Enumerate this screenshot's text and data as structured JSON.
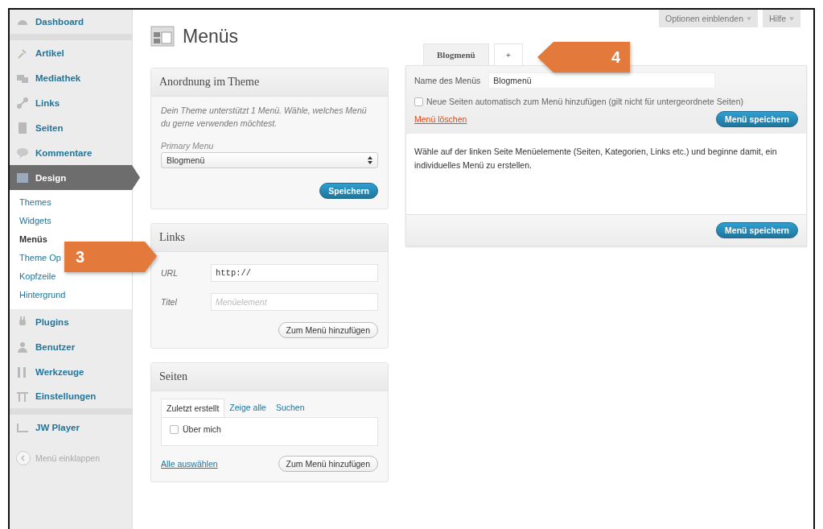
{
  "sidebar": {
    "items": [
      {
        "label": "Dashboard",
        "selected": false,
        "group_end": true
      },
      {
        "label": "Artikel",
        "selected": false
      },
      {
        "label": "Mediathek",
        "selected": false
      },
      {
        "label": "Links",
        "selected": false
      },
      {
        "label": "Seiten",
        "selected": false
      },
      {
        "label": "Kommentare",
        "selected": false
      },
      {
        "label": "Design",
        "selected": true,
        "children": [
          {
            "label": "Themes",
            "selected": false
          },
          {
            "label": "Widgets",
            "selected": false
          },
          {
            "label": "Menüs",
            "selected": true
          },
          {
            "label": "Theme Op",
            "selected": false
          },
          {
            "label": "Kopfzeile",
            "selected": false
          },
          {
            "label": "Hintergrund",
            "selected": false
          }
        ]
      },
      {
        "label": "Plugins",
        "selected": false
      },
      {
        "label": "Benutzer",
        "selected": false
      },
      {
        "label": "Werkzeuge",
        "selected": false
      },
      {
        "label": "Einstellungen",
        "selected": false,
        "group_end": true
      },
      {
        "label": "JW Player",
        "selected": false
      }
    ],
    "collapse": "Menü einklappen"
  },
  "page_title": "Menüs",
  "screen_buttons": [
    "Optionen einblenden",
    "Hilfe"
  ],
  "theme_box": {
    "title": "Anordnung im Theme",
    "note": "Dein Theme unterstützt 1 Menü. Wähle, welches Menü du gerne verwenden möchtest.",
    "select_label": "Primary Menu",
    "select_value": "Blogmenü",
    "button": "Speichern"
  },
  "links_box": {
    "title": "Links",
    "url_label": "URL",
    "url_value": "http://",
    "title_label": "Titel",
    "title_placeholder": "Menüelement",
    "button": "Zum Menü hinzufügen"
  },
  "pages_box": {
    "title": "Seiten",
    "tabs": [
      {
        "label": "Zuletzt erstellt",
        "selected": true
      },
      {
        "label": "Zeige alle",
        "selected": false
      },
      {
        "label": "Suchen",
        "selected": false
      }
    ],
    "pages": [
      {
        "label": "Über mich",
        "checked": false
      }
    ],
    "select_all": "Alle auswählen",
    "button": "Zum Menü hinzufügen"
  },
  "menu_tabs": [
    {
      "label": "Blogmenü",
      "selected": true
    },
    {
      "label": "+",
      "selected": false
    }
  ],
  "menu_editor": {
    "name_label": "Name des Menüs",
    "name_value": "Blogmenü",
    "auto_add": {
      "label": "Neue Seiten automatisch zum Menü hinzufügen (gilt nicht für untergeordnete Seiten)",
      "checked": false
    },
    "delete": "Menü löschen",
    "save": "Menü speichern",
    "hint": "Wähle auf der linken Seite Menüelemente (Seiten, Kategorien, Links etc.) und beginne damit, ein individuelles Menü zu erstellen.",
    "save_bottom": "Menü speichern"
  },
  "callouts": [
    {
      "label": "3",
      "kind": "rightward"
    },
    {
      "label": "4",
      "kind": "leftward"
    }
  ]
}
